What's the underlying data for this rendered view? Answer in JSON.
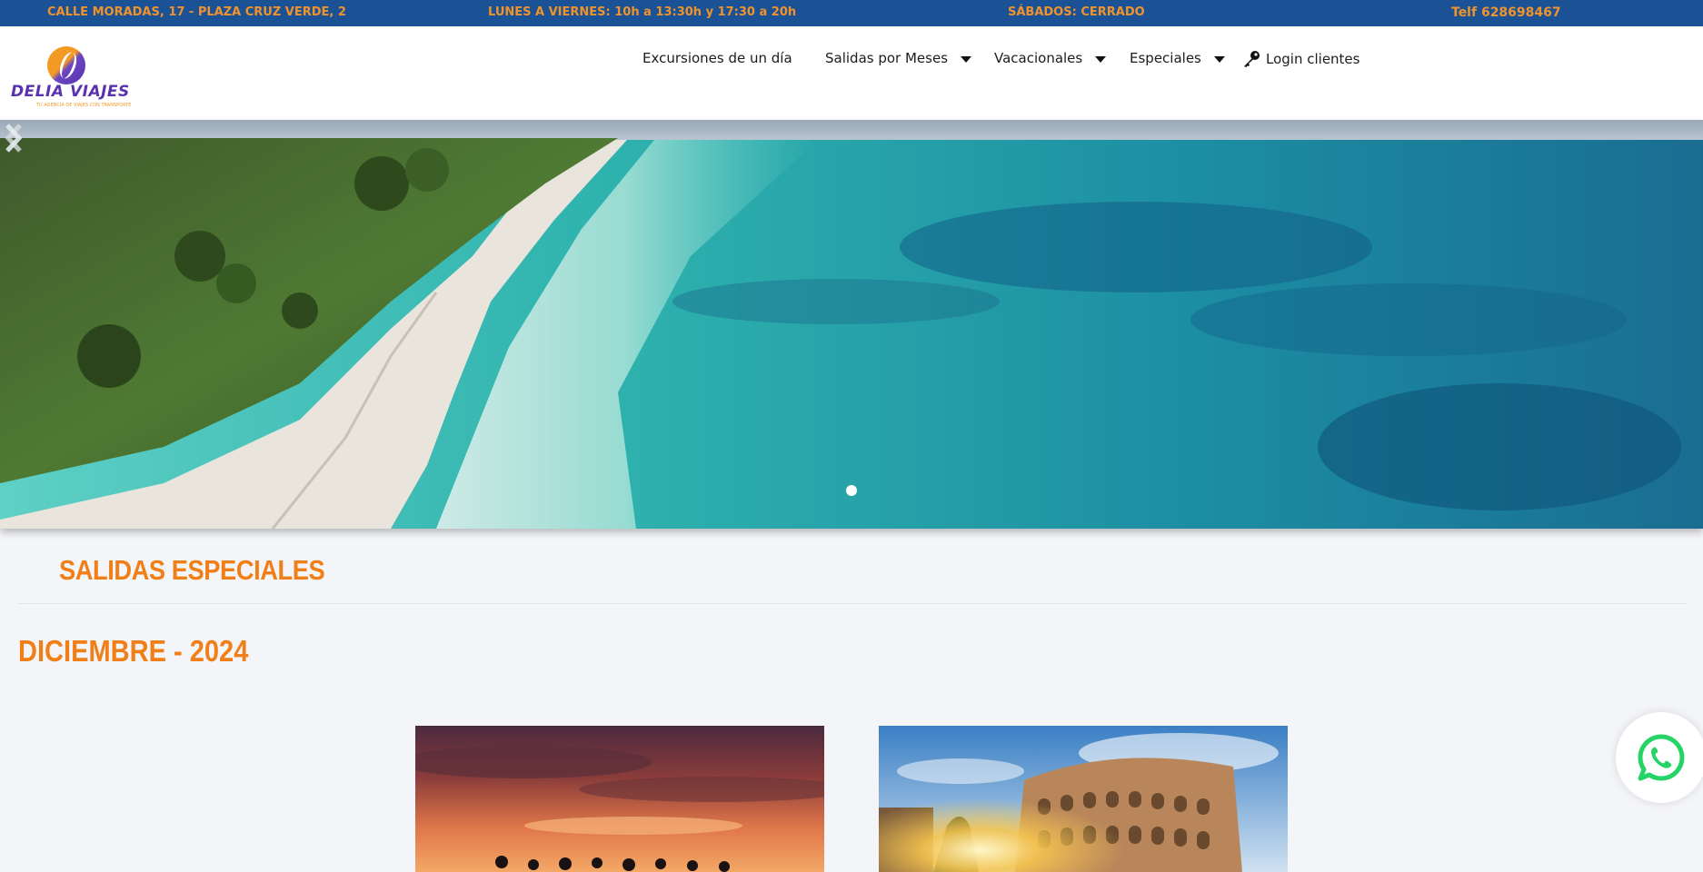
{
  "topbar": {
    "address": "CALLE MORADAS, 17   -   PLAZA CRUZ VERDE, 2",
    "hours": "LUNES A VIERNES: 10h a 13:30h y 17:30 a 20h",
    "saturday": "SÁBADOS: CERRADO",
    "phone": "Telf  628698467"
  },
  "logo": {
    "name": "DELIA VIAJES",
    "tagline": "TU AGENCIA DE VIAJES CON TRANSPORTE"
  },
  "nav": {
    "items": [
      {
        "label": "Excursiones de un día",
        "dropdown": false
      },
      {
        "label": "Salidas por Meses",
        "dropdown": true
      },
      {
        "label": "Vacacionales",
        "dropdown": true
      },
      {
        "label": "Especiales",
        "dropdown": true
      },
      {
        "label": "Login clientes",
        "icon": "key-icon"
      }
    ]
  },
  "hero": {
    "slides": 1,
    "active_slide": 1,
    "prev_icon": "chevron-left-icon",
    "next_icon": "chevron-right-icon",
    "image": "aerial beach with turquoise sea"
  },
  "content": {
    "section_title": "SALIDAS ESPECIALES",
    "month_title": "DICIEMBRE - 2024",
    "cards": [
      {
        "image": "sunset silhouettes"
      },
      {
        "image": "colosseum at sunrise"
      }
    ]
  },
  "floating": {
    "whatsapp_icon": "whatsapp-icon"
  },
  "colors": {
    "topbar_bg": "#1b5296",
    "accent_orange": "#f07f18",
    "page_bg": "#f4f5f9",
    "brand_purple": "#5a32b0"
  }
}
